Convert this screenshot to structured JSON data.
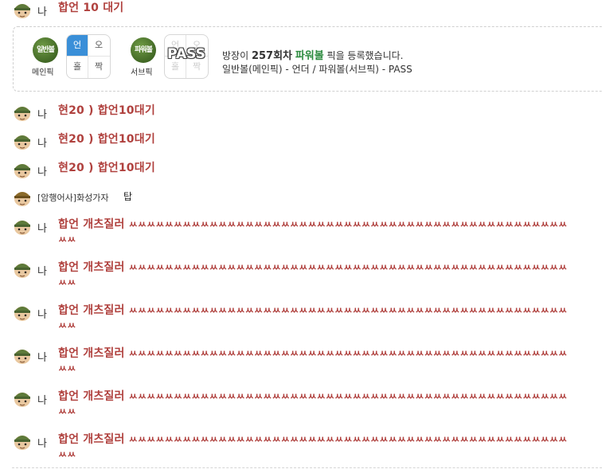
{
  "messages_top": [
    {
      "nick": "나",
      "text": "합언 10 대기"
    }
  ],
  "pick": {
    "main_ball_label": "일반볼",
    "main_caption": "메인픽",
    "main_grid": [
      "언",
      "오",
      "홀",
      "짝"
    ],
    "main_selected": "언",
    "sub_ball_label": "파워볼",
    "sub_caption": "서브픽",
    "sub_grid": [
      "언",
      "오",
      "홀",
      "짝"
    ],
    "sub_pass_label": "PASS",
    "line1_prefix": "방장이 ",
    "line1_round": "257회차",
    "line1_power": "파워볼",
    "line1_suffix": " 픽을 등록했습니다.",
    "line2": "일반볼(메인픽) - 언더 / 파워볼(서브픽) - PASS"
  },
  "messages": [
    {
      "nick": "나",
      "text": "현20 ) 합언10대기"
    },
    {
      "nick": "나",
      "text": "현20 ) 합언10대기"
    },
    {
      "nick": "나",
      "text": "현20 ) 합언10대기"
    },
    {
      "nick": "[암행어사]화성가자",
      "text": "탑"
    },
    {
      "nick": "나",
      "text_main": "합언 개츠질러",
      "text_laugh": "ㅆㅆㅆㅆㅆㅆㅆㅆㅆㅆㅆㅆㅆㅆㅆㅆㅆㅆㅆㅆㅆㅆㅆㅆㅆㅆㅆㅆㅆㅆㅆㅆㅆㅆㅆㅆㅆㅆㅆㅆㅆㅆㅆㅆㅆㅆㅆㅆㅆㅆㅆ"
    },
    {
      "nick": "나",
      "text_main": "합언 개츠질러",
      "text_laugh": "ㅆㅆㅆㅆㅆㅆㅆㅆㅆㅆㅆㅆㅆㅆㅆㅆㅆㅆㅆㅆㅆㅆㅆㅆㅆㅆㅆㅆㅆㅆㅆㅆㅆㅆㅆㅆㅆㅆㅆㅆㅆㅆㅆㅆㅆㅆㅆㅆㅆㅆㅆ"
    },
    {
      "nick": "나",
      "text_main": "합언 개츠질러",
      "text_laugh": "ㅆㅆㅆㅆㅆㅆㅆㅆㅆㅆㅆㅆㅆㅆㅆㅆㅆㅆㅆㅆㅆㅆㅆㅆㅆㅆㅆㅆㅆㅆㅆㅆㅆㅆㅆㅆㅆㅆㅆㅆㅆㅆㅆㅆㅆㅆㅆㅆㅆㅆㅆ"
    },
    {
      "nick": "나",
      "text_main": "합언 개츠질러",
      "text_laugh": "ㅆㅆㅆㅆㅆㅆㅆㅆㅆㅆㅆㅆㅆㅆㅆㅆㅆㅆㅆㅆㅆㅆㅆㅆㅆㅆㅆㅆㅆㅆㅆㅆㅆㅆㅆㅆㅆㅆㅆㅆㅆㅆㅆㅆㅆㅆㅆㅆㅆㅆㅆ"
    },
    {
      "nick": "나",
      "text_main": "합언 개츠질러",
      "text_laugh": "ㅆㅆㅆㅆㅆㅆㅆㅆㅆㅆㅆㅆㅆㅆㅆㅆㅆㅆㅆㅆㅆㅆㅆㅆㅆㅆㅆㅆㅆㅆㅆㅆㅆㅆㅆㅆㅆㅆㅆㅆㅆㅆㅆㅆㅆㅆㅆㅆㅆㅆㅆ"
    },
    {
      "nick": "나",
      "text_main": "합언 개츠질러",
      "text_laugh": "ㅆㅆㅆㅆㅆㅆㅆㅆㅆㅆㅆㅆㅆㅆㅆㅆㅆㅆㅆㅆㅆㅆㅆㅆㅆㅆㅆㅆㅆㅆㅆㅆㅆㅆㅆㅆㅆㅆㅆㅆㅆㅆㅆㅆㅆㅆㅆㅆㅆㅆㅆ"
    }
  ],
  "colors": {
    "message_text": "#b0413e",
    "selected_cell": "#3a8fd8",
    "main_ball": "#3d6b2a",
    "sub_ball": "#3d6b2a",
    "power_text": "#2b8a3e"
  },
  "icons": {
    "avatar": "soldier-avatar-icon"
  }
}
